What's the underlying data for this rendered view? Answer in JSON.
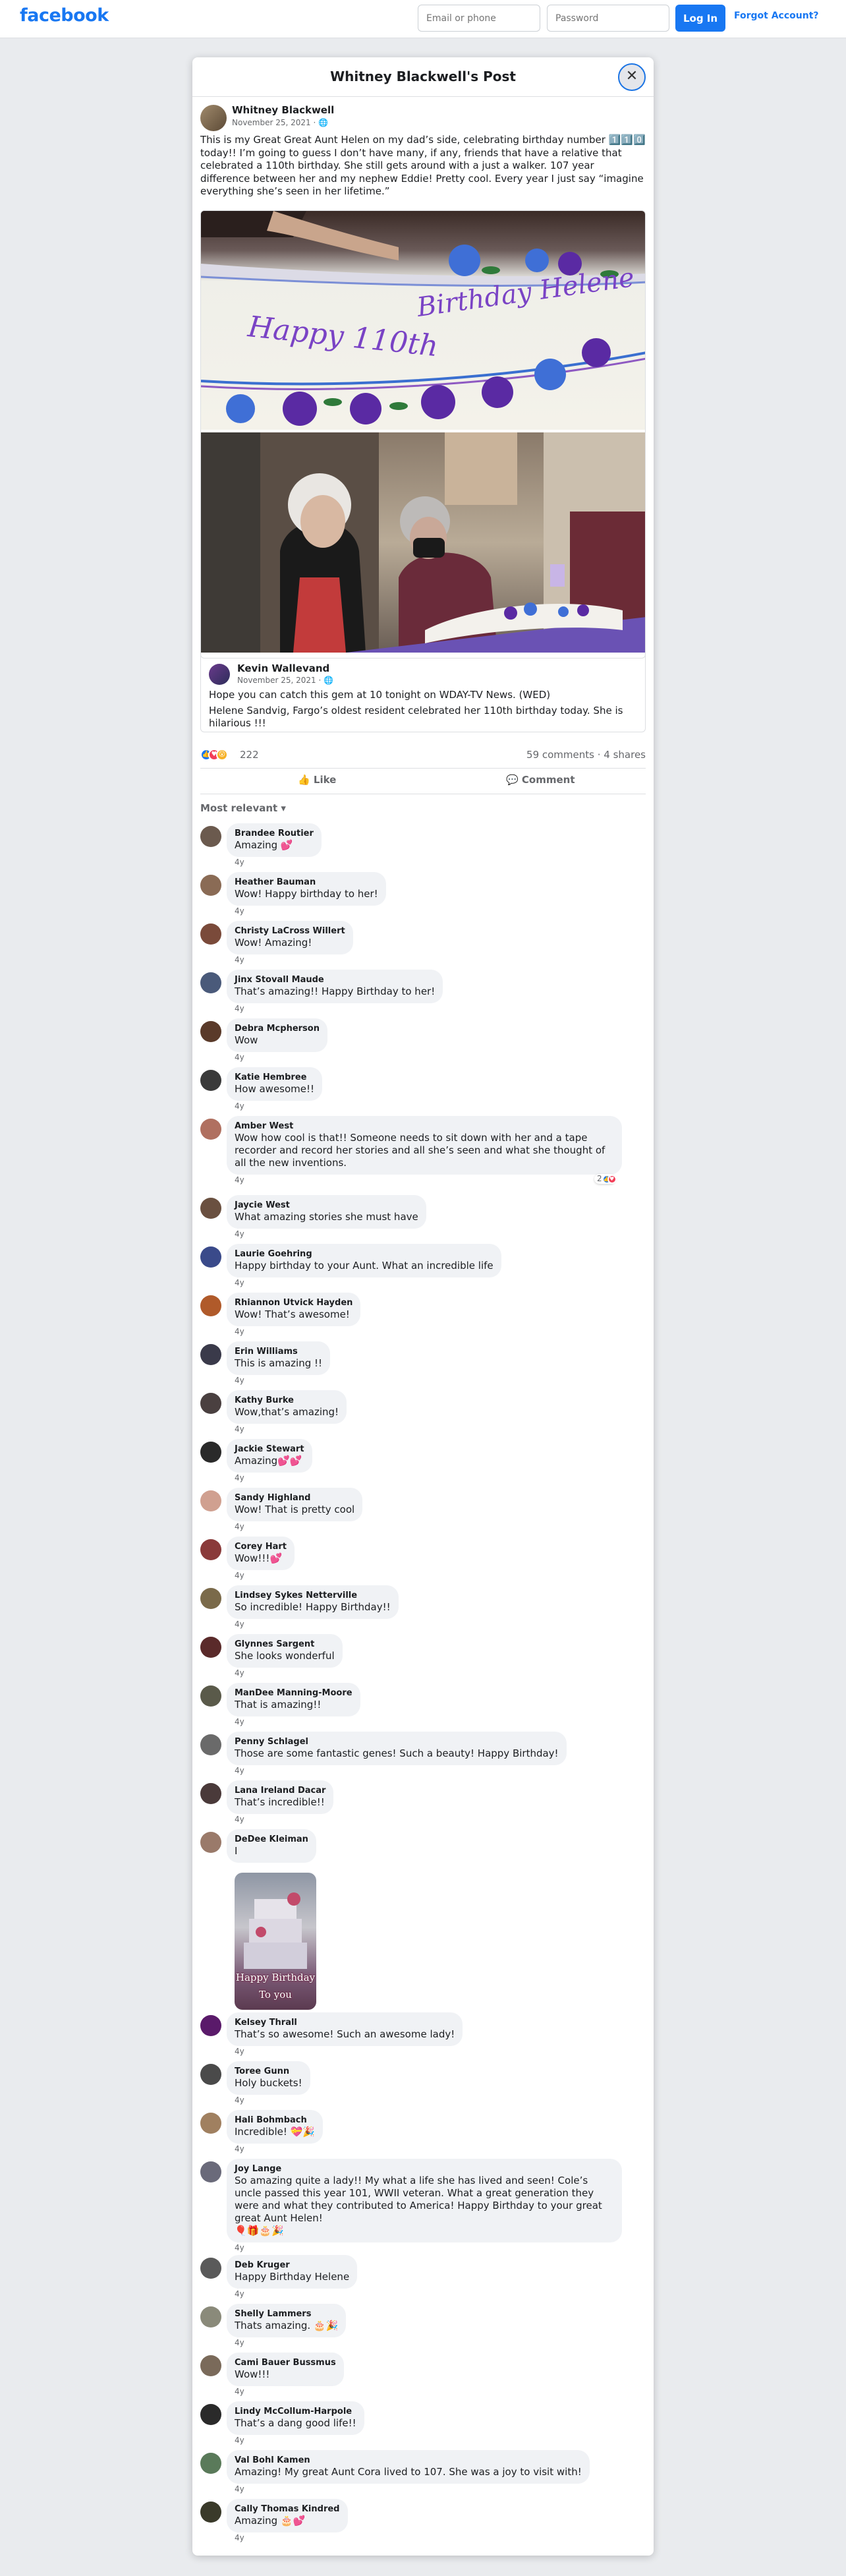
{
  "topbar": {
    "logo": "facebook",
    "email_placeholder": "Email or phone",
    "password_placeholder": "Password",
    "login_label": "Log In",
    "forgot_label": "Forgot Account?"
  },
  "modal": {
    "title": "Whitney Blackwell's Post",
    "close_icon": "close-icon"
  },
  "post": {
    "author": "Whitney Blackwell",
    "date": "November 25, 2021 · ",
    "privacy_icon": "globe-icon",
    "text": "This is my Great Great Aunt Helen on my dad’s side, celebrating birthday number 1️⃣1️⃣0️⃣ today!! I’m going to guess I don’t have many, if any, friends that have a relative that celebrated a 110th birthday. She still gets around with a just a walker. 107 year difference between her and my nephew Eddie! Pretty cool. Every year I just say “imagine everything she’s seen in her lifetime.”",
    "cake_text_line1": "Happy 110th",
    "cake_text_line2": "Birthday Helene",
    "shared": {
      "author": "Kevin Wallevand",
      "date": "November 25, 2021 · ",
      "text1": "Hope you can catch this gem at 10 tonight on WDAY-TV News. (WED)",
      "text2": "Helene Sandvig, Fargo’s oldest resident celebrated her 110th birthday today. She is hilarious !!!"
    },
    "reactions_count": "222",
    "comments_count": "59 comments",
    "shares_count": "4 shares",
    "like_label": "Like",
    "comment_label": "Comment",
    "sort_label": "Most relevant"
  },
  "comments": [
    {
      "name": "Brandee Routier",
      "text": "Amazing 💕",
      "time": "4y"
    },
    {
      "name": "Heather Bauman",
      "text": "Wow! Happy birthday to her!",
      "time": "4y"
    },
    {
      "name": "Christy LaCross Willert",
      "text": "Wow! Amazing!",
      "time": "4y"
    },
    {
      "name": "Jinx Stovall Maude",
      "text": "That’s amazing!! Happy Birthday to her!",
      "time": "4y"
    },
    {
      "name": "Debra Mcpherson",
      "text": "Wow",
      "time": "4y"
    },
    {
      "name": "Katie Hembree",
      "text": "How awesome!!",
      "time": "4y"
    },
    {
      "name": "Amber West",
      "text": "Wow how cool is that!! Someone needs to sit down with her and a tape recorder and record her stories and all she’s seen and what she thought of all the new inventions.",
      "time": "4y",
      "reactions": "2"
    },
    {
      "name": "Jaycie West",
      "text": "What amazing stories she must have",
      "time": "4y"
    },
    {
      "name": "Laurie Goehring",
      "text": "Happy birthday to your Aunt. What an incredible life",
      "time": "4y"
    },
    {
      "name": "Rhiannon Utvick Hayden",
      "text": "Wow! That’s awesome!",
      "time": "4y"
    },
    {
      "name": "Erin Williams",
      "text": "This is amazing !!",
      "time": "4y"
    },
    {
      "name": "Kathy Burke",
      "text": "Wow,that’s amazing!",
      "time": "4y"
    },
    {
      "name": "Jackie Stewart",
      "text": "Amazing💕💕",
      "time": "4y"
    },
    {
      "name": "Sandy Highland",
      "text": "Wow! That is pretty cool",
      "time": "4y"
    },
    {
      "name": "Corey Hart",
      "text": "Wow!!!💕",
      "time": "4y"
    },
    {
      "name": "Lindsey Sykes Netterville",
      "text": "So incredible! Happy Birthday!!",
      "time": "4y"
    },
    {
      "name": "Glynnes Sargent",
      "text": "She looks wonderful",
      "time": "4y"
    },
    {
      "name": "ManDee Manning-Moore",
      "text": "That is amazing!!",
      "time": "4y"
    },
    {
      "name": "Penny Schlagel",
      "text": "Those are some fantastic genes! Such a beauty! Happy Birthday!",
      "time": "4y"
    },
    {
      "name": "Lana Ireland Dacar",
      "text": "That’s incredible!!",
      "time": "4y"
    },
    {
      "name": "DeDee Kleiman",
      "text": "I",
      "time": "4y",
      "gif_line1": "Happy Birthday",
      "gif_line2": "To you"
    },
    {
      "name": "Kelsey Thrall",
      "text": "That’s so awesome! Such an awesome lady!",
      "time": "4y"
    },
    {
      "name": "Toree Gunn",
      "text": "Holy buckets!",
      "time": "4y"
    },
    {
      "name": "Hali Bohmbach",
      "text": "Incredible! 💝🎉",
      "time": "4y"
    },
    {
      "name": "Joy Lange",
      "text": "So amazing quite a lady!! My what a life she has lived and seen! Cole’s uncle passed this year 101, WWII veteran. What a great generation they were and what they contributed to America! Happy Birthday to your great great Aunt Helen!",
      "text2": "🎈🎁🎂🎉",
      "time": "4y"
    },
    {
      "name": "Deb Kruger",
      "text": "Happy Birthday Helene",
      "time": "4y"
    },
    {
      "name": "Shelly Lammers",
      "text": "Thats amazing. 🎂🎉",
      "time": "4y"
    },
    {
      "name": "Cami Bauer Bussmus",
      "text": "Wow!!!",
      "time": "4y"
    },
    {
      "name": "Lindy McCollum-Harpole",
      "text": "That’s a dang good life!!",
      "time": "4y"
    },
    {
      "name": "Val Bohl Kamen",
      "text": "Amazing! My great Aunt Cora lived to 107. She was a joy to visit with!",
      "time": "4y"
    },
    {
      "name": "Cally Thomas Kindred",
      "text": "Amazing 🎂💕",
      "time": "4y"
    }
  ],
  "colors": {
    "brand": "#1877f2",
    "page_bg": "#e9ebee",
    "bubble_bg": "#f0f2f5"
  }
}
